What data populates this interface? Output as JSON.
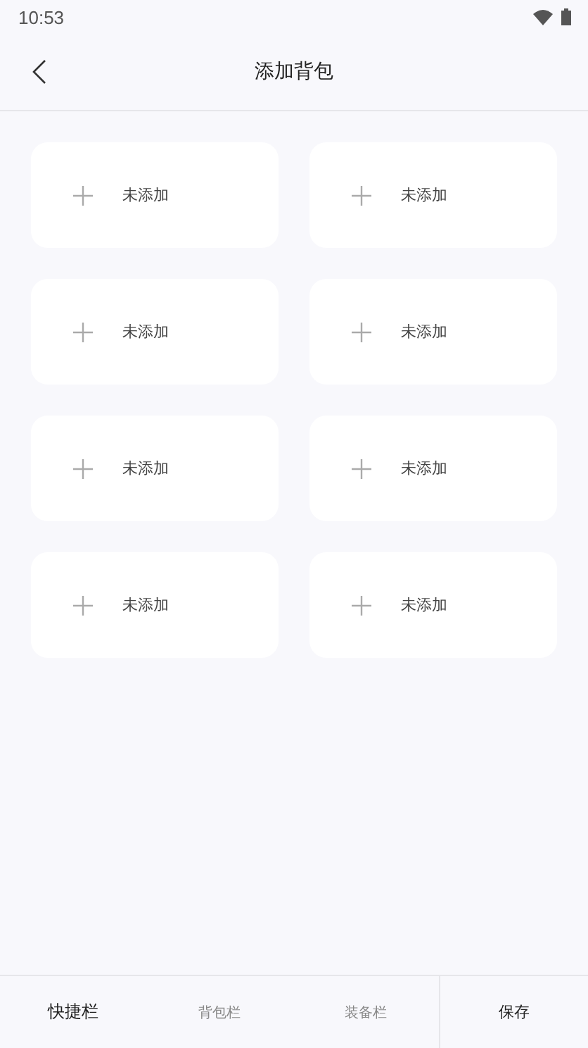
{
  "status_bar": {
    "time": "10:53"
  },
  "header": {
    "title": "添加背包"
  },
  "slots": [
    {
      "label": "未添加"
    },
    {
      "label": "未添加"
    },
    {
      "label": "未添加"
    },
    {
      "label": "未添加"
    },
    {
      "label": "未添加"
    },
    {
      "label": "未添加"
    },
    {
      "label": "未添加"
    },
    {
      "label": "未添加"
    }
  ],
  "tabs": [
    {
      "label": "快捷栏",
      "selected": true
    },
    {
      "label": "背包栏",
      "selected": false
    },
    {
      "label": "装备栏",
      "selected": false
    }
  ],
  "save_button": "保存"
}
